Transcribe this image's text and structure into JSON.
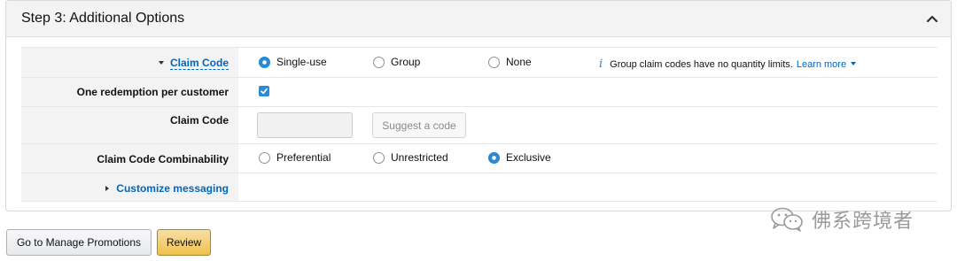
{
  "panel": {
    "title": "Step 3: Additional Options",
    "collapse_icon": "chevron-up-icon"
  },
  "rows": {
    "claim_type": {
      "label": "Claim Code",
      "options": [
        "Single-use",
        "Group",
        "None"
      ],
      "selected": "Single-use",
      "info_icon": "i",
      "info_text": "Group claim codes have no quantity limits.",
      "learn_more": "Learn more"
    },
    "one_redemption": {
      "label": "One redemption per customer",
      "checked": true
    },
    "claim_code": {
      "label": "Claim Code",
      "input_value": "",
      "suggest_label": "Suggest a code"
    },
    "combinability": {
      "label": "Claim Code Combinability",
      "options": [
        "Preferential",
        "Unrestricted",
        "Exclusive"
      ],
      "selected": "Exclusive"
    },
    "customize": {
      "label": "Customize messaging"
    }
  },
  "buttons": {
    "manage": "Go to Manage Promotions",
    "review": "Review"
  },
  "watermark": {
    "text": "佛系跨境者",
    "icon": "wechat-icon"
  },
  "colors": {
    "accent": "#2a8ad4",
    "link": "#0066c0",
    "review_button": "#f0c14b"
  }
}
